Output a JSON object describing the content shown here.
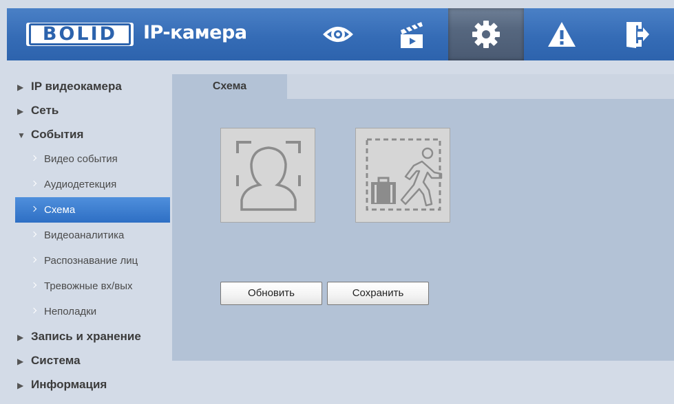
{
  "header": {
    "logo_text": "BOLID",
    "app_title": "IP-камера",
    "nav": [
      {
        "icon": "eye-icon",
        "active": false
      },
      {
        "icon": "clapperboard-icon",
        "active": false
      },
      {
        "icon": "gear-icon",
        "active": true
      },
      {
        "icon": "warning-icon",
        "active": false
      },
      {
        "icon": "logout-icon",
        "active": false
      }
    ]
  },
  "sidebar": {
    "categories": [
      {
        "label": "IP видеокамера",
        "expanded": false
      },
      {
        "label": "Сеть",
        "expanded": false
      },
      {
        "label": "События",
        "expanded": true
      },
      {
        "label": "Запись и хранение",
        "expanded": false
      },
      {
        "label": "Система",
        "expanded": false
      },
      {
        "label": "Информация",
        "expanded": false
      }
    ],
    "events_items": [
      {
        "label": "Видео события"
      },
      {
        "label": "Аудиодетекция"
      },
      {
        "label": "Схема",
        "active": true
      },
      {
        "label": "Видеоаналитика"
      },
      {
        "label": "Распознавание лиц"
      },
      {
        "label": "Тревожные вх/вых"
      },
      {
        "label": "Неполадки"
      }
    ]
  },
  "main": {
    "tab_label": "Схема",
    "tiles": [
      {
        "icon": "face-detection-icon"
      },
      {
        "icon": "abandoned-object-icon"
      }
    ],
    "refresh_label": "Обновить",
    "save_label": "Сохранить"
  },
  "colors": {
    "header_blue": "#356cb6",
    "active_nav": "#56677f",
    "page_bg": "#d3dbe7",
    "panel_bg": "#b3c2d6",
    "selected_item": "#2e6fc4"
  }
}
